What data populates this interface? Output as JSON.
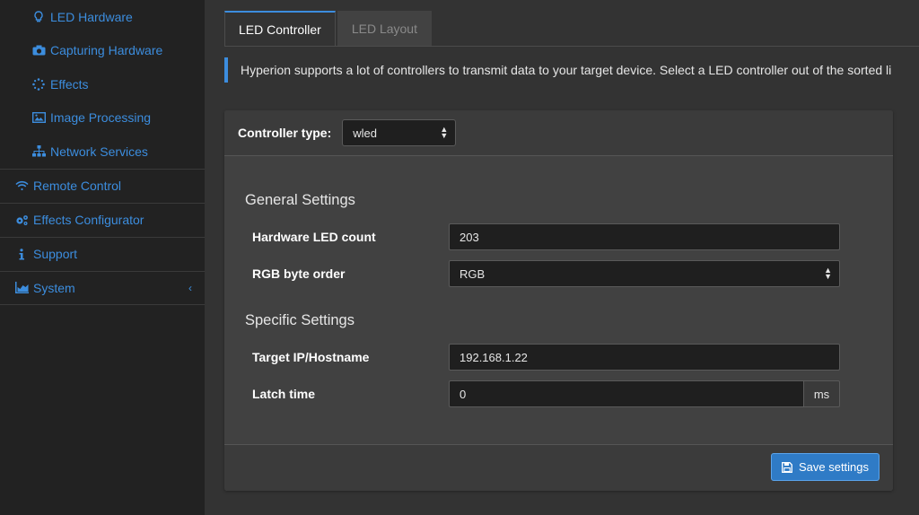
{
  "sidebar": {
    "sub_items": [
      {
        "label": "LED Hardware",
        "icon": "lightbulb-icon"
      },
      {
        "label": "Capturing Hardware",
        "icon": "camera-icon"
      },
      {
        "label": "Effects",
        "icon": "spinner-icon"
      },
      {
        "label": "Image Processing",
        "icon": "image-icon"
      },
      {
        "label": "Network Services",
        "icon": "sitemap-icon"
      }
    ],
    "items": [
      {
        "label": "Remote Control",
        "icon": "wifi-icon"
      },
      {
        "label": "Effects Configurator",
        "icon": "cogs-icon"
      },
      {
        "label": "Support",
        "icon": "info-icon"
      },
      {
        "label": "System",
        "icon": "chart-icon"
      }
    ]
  },
  "tabs": [
    {
      "label": "LED Controller",
      "active": true
    },
    {
      "label": "LED Layout",
      "active": false
    }
  ],
  "callout": {
    "text": "Hyperion supports a lot of controllers to transmit data to your target device. Select a LED controller out of the sorted li"
  },
  "panel": {
    "controller_label": "Controller type:",
    "controller_value": "wled",
    "general_title": "General Settings",
    "led_count_label": "Hardware LED count",
    "led_count_value": "203",
    "byte_order_label": "RGB byte order",
    "byte_order_value": "RGB",
    "specific_title": "Specific Settings",
    "target_label": "Target IP/Hostname",
    "target_value": "192.168.1.22",
    "latch_label": "Latch time",
    "latch_value": "0",
    "latch_unit": "ms",
    "save_label": "Save settings"
  },
  "colors": {
    "accent": "#3c8dde",
    "sidebar_bg": "#222222",
    "content_bg": "#333333",
    "panel_bg": "#414141",
    "button_bg": "#2f7bc6"
  }
}
